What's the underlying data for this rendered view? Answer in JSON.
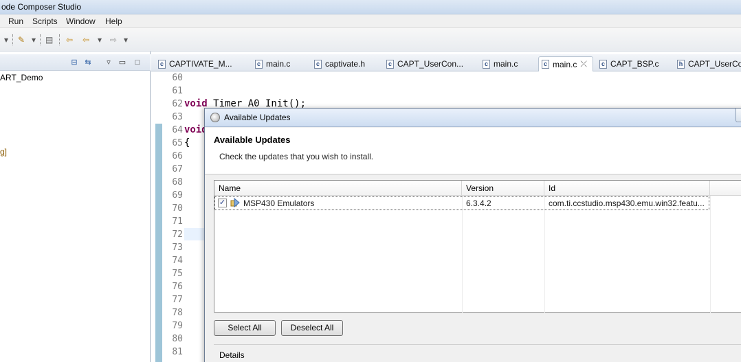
{
  "window": {
    "title": "ode Composer Studio"
  },
  "menubar": {
    "items": [
      "Run",
      "Scripts",
      "Window",
      "Help"
    ]
  },
  "explorer": {
    "project_fragment": "ART_Demo",
    "config_fragment": "g]"
  },
  "editor": {
    "tabs": [
      {
        "label": "CAPTIVATE_M...",
        "icon": "c-file-icon"
      },
      {
        "label": "main.c",
        "icon": "c-file-icon"
      },
      {
        "label": "captivate.h",
        "icon": "c-file-icon"
      },
      {
        "label": "CAPT_UserCon...",
        "icon": "c-file-icon"
      },
      {
        "label": "main.c",
        "icon": "c-file-icon"
      },
      {
        "label": "main.c",
        "icon": "c-file-icon",
        "active": true,
        "close": "⤫"
      },
      {
        "label": "CAPT_BSP.c",
        "icon": "c-file-icon"
      },
      {
        "label": "CAPT_UserCon",
        "icon": "h-file-icon"
      }
    ],
    "line_numbers": [
      "60",
      "61",
      "62",
      "63",
      "64",
      "65",
      "66",
      "67",
      "68",
      "69",
      "70",
      "71",
      "72",
      "73",
      "74",
      "75",
      "76",
      "77",
      "78",
      "79",
      "80",
      "81"
    ],
    "code": {
      "l62_kw": "void",
      "l62_rest": " Timer_A0_Init();",
      "l64_kw": "void",
      "l65": "{"
    }
  },
  "dialog": {
    "title": "Available Updates",
    "header": "Available Updates",
    "description": "Check the updates that you wish to install.",
    "columns": {
      "name": "Name",
      "version": "Version",
      "id": "Id"
    },
    "rows": [
      {
        "checked": true,
        "check_mark": "✓",
        "name": "MSP430 Emulators",
        "version": "6.3.4.2",
        "id": "com.ti.ccstudio.msp430.emu.win32.featu..."
      }
    ],
    "buttons": {
      "select_all": "Select All",
      "deselect_all": "Deselect All"
    },
    "details_label": "Details"
  }
}
